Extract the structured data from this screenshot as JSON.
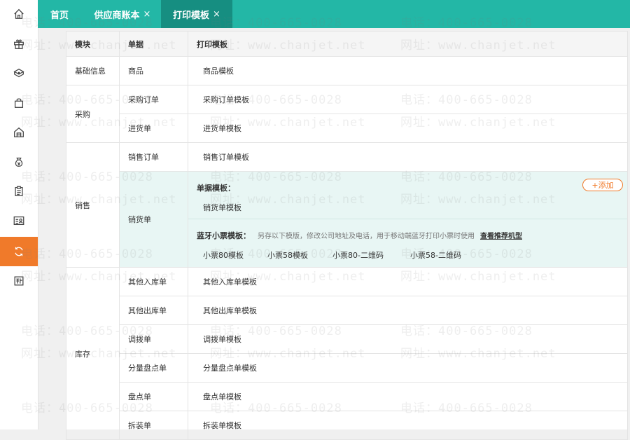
{
  "tabs": [
    {
      "label": "首页",
      "closable": false,
      "active": false
    },
    {
      "label": "供应商账本",
      "closable": true,
      "active": false
    },
    {
      "label": "打印模板",
      "closable": true,
      "active": true
    }
  ],
  "tab_close_glyph": "×",
  "sidebar": {
    "items": [
      {
        "icon": "home-icon",
        "active": false
      },
      {
        "icon": "gift-icon",
        "active": false
      },
      {
        "icon": "box-icon",
        "active": false
      },
      {
        "icon": "shopping-bag-icon",
        "active": false
      },
      {
        "icon": "warehouse-icon",
        "active": false
      },
      {
        "icon": "money-bag-icon",
        "active": false
      },
      {
        "icon": "clipboard-icon",
        "active": false
      },
      {
        "icon": "contact-card-icon",
        "active": false
      },
      {
        "icon": "refresh-icon",
        "active": true
      },
      {
        "icon": "new-badge-icon",
        "active": false
      }
    ],
    "active_color": "#f07a2a"
  },
  "table": {
    "headers": [
      "模块",
      "单据",
      "打印模板"
    ],
    "modules": {
      "basic": "基础信息",
      "purchase": "采购",
      "sales": "销售",
      "inventory": "库存"
    },
    "rows": {
      "goods": {
        "doc": "商品",
        "template": "商品模板"
      },
      "purchase_order": {
        "doc": "采购订单",
        "template": "采购订单模板"
      },
      "receipt": {
        "doc": "进货单",
        "template": "进货单模板"
      },
      "sales_order": {
        "doc": "销售订单",
        "template": "销售订单模板"
      },
      "delivery": {
        "doc": "销货单"
      },
      "other_in": {
        "doc": "其他入库单",
        "template": "其他入库单模板"
      },
      "other_out": {
        "doc": "其他出库单",
        "template": "其他出库单模板"
      },
      "transfer": {
        "doc": "调拨单",
        "template": "调拨单模板"
      },
      "partial_count": {
        "doc": "分量盘点单",
        "template": "分量盘点单模板"
      },
      "stock_count": {
        "doc": "盘点单",
        "template": "盘点单模板"
      },
      "assembly": {
        "doc": "拆装单",
        "template": "拆装单模板"
      }
    },
    "delivery_panel": {
      "doc_template_title": "单据模板：",
      "doc_template_item": "销货单模板",
      "add_button": "+添加",
      "bt_title": "蓝牙小票模板：",
      "bt_desc": "另存以下模版，修改公司地址及电话，用于移动端蓝牙打印小票时使用",
      "bt_link": "查看推荐机型",
      "bt_items": [
        "小票80模板",
        "小票58模板",
        "小票80-二维码",
        "小票58-二维码"
      ]
    }
  },
  "watermark": {
    "phone": "电话：400-665-0028",
    "site": "网址：www.chanjet.net"
  },
  "colors": {
    "topbar": "#23b7a6",
    "active_tab": "#168e81",
    "accent": "#f07a2a",
    "highlight_row": "#e8f6f4"
  }
}
